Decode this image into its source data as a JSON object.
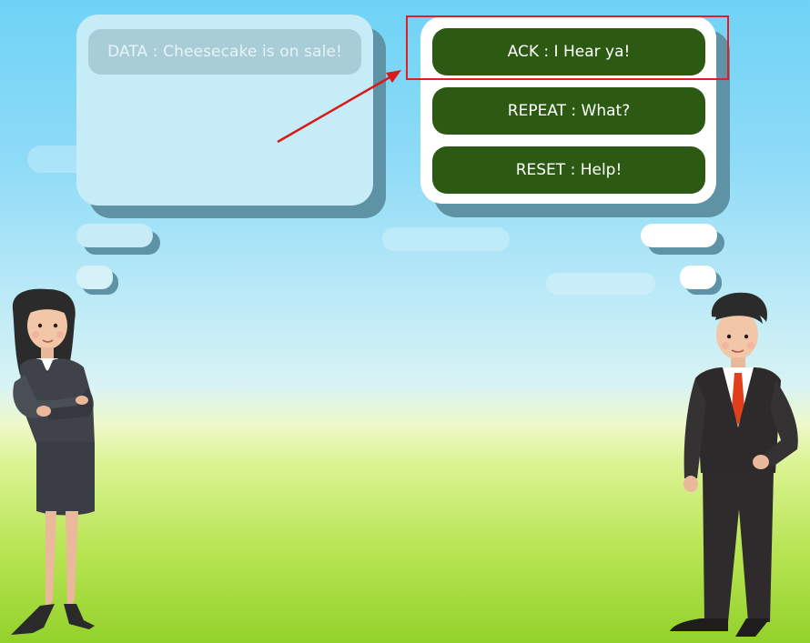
{
  "left_bubble": {
    "data_text": "DATA : Cheesecake is on sale!"
  },
  "right_bubble": {
    "options": [
      {
        "label": "ACK : I Hear ya!"
      },
      {
        "label": "REPEAT : What?"
      },
      {
        "label": "RESET : Help!"
      }
    ]
  },
  "annotation": {
    "highlight_color": "#e02020",
    "highlighted_option": "ACK : I Hear ya!"
  },
  "colors": {
    "button_green": "#2d5a12",
    "bubble_shadow": "#5e93a6"
  },
  "characters": {
    "left": "woman-in-skirt-suit",
    "right": "man-in-business-suit"
  }
}
